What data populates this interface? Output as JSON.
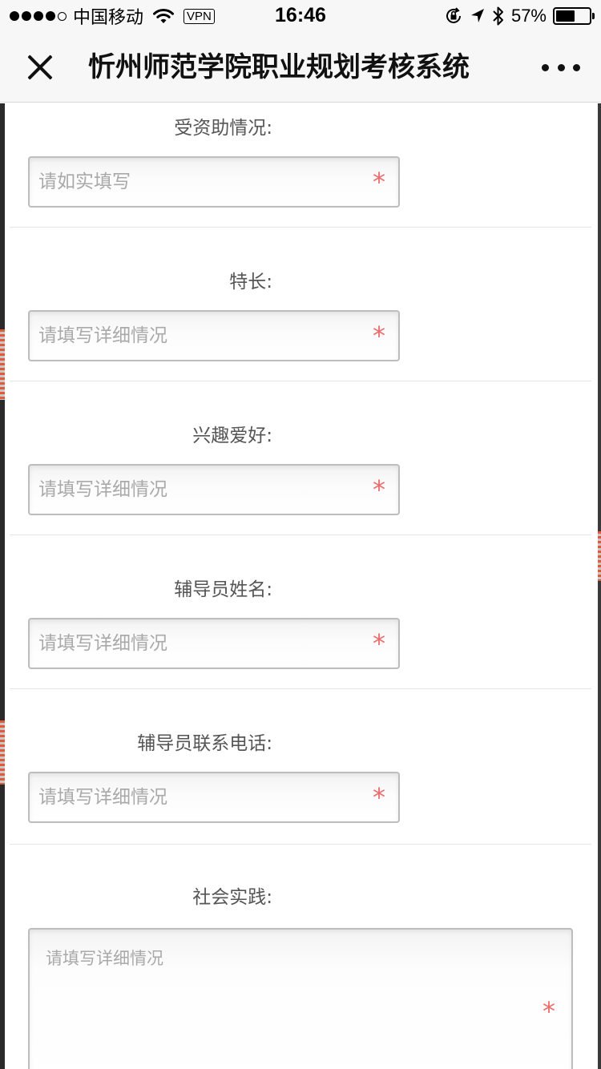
{
  "status_bar": {
    "carrier": "中国移动",
    "vpn": "VPN",
    "time": "16:46",
    "battery_percent": "57%",
    "battery_level": 0.57,
    "icons": [
      "signal-icon",
      "wifi-icon",
      "orientation-lock-icon",
      "location-icon",
      "bluetooth-icon",
      "battery-icon"
    ]
  },
  "nav": {
    "title": "忻州师范学院职业规划考核系统",
    "close_icon": "close-icon",
    "more_icon": "more-icon"
  },
  "form": {
    "required_mark": "*",
    "fields": [
      {
        "label": "受资助情况:",
        "placeholder": "请如实填写",
        "value": ""
      },
      {
        "label": "特长:",
        "placeholder": "请填写详细情况",
        "value": ""
      },
      {
        "label": "兴趣爱好:",
        "placeholder": "请填写详细情况",
        "value": ""
      },
      {
        "label": "辅导员姓名:",
        "placeholder": "请填写详细情况",
        "value": ""
      },
      {
        "label": "辅导员联系电话:",
        "placeholder": "请填写详细情况",
        "value": ""
      },
      {
        "label": "社会实践:",
        "placeholder": "请填写详细情况",
        "value": ""
      }
    ]
  },
  "colors": {
    "nav_bg": "#f7f7f7",
    "required": "#ee6b6b",
    "placeholder": "#a9a9a9",
    "label": "#555555"
  }
}
